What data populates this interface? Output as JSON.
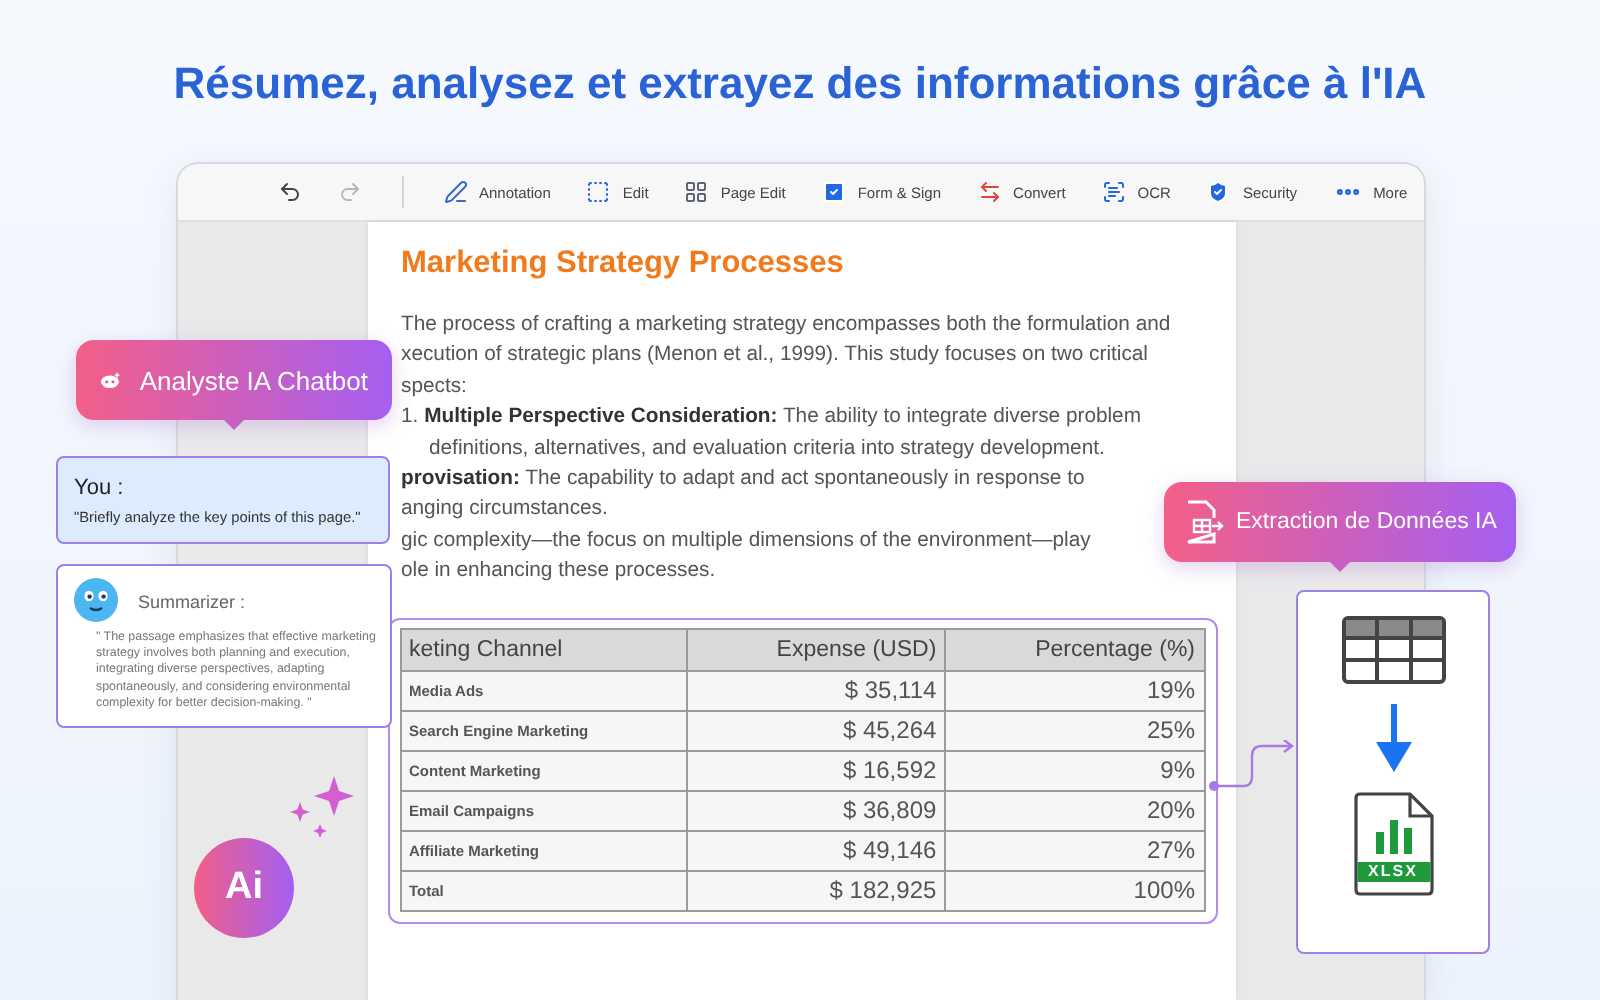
{
  "headline": "Résumez, analysez et extrayez des informations grâce à l'IA",
  "toolbar": {
    "history": [
      {
        "kind": "undo",
        "disabled": false
      },
      {
        "kind": "redo",
        "disabled": true
      }
    ],
    "tools": [
      {
        "kind": "annotation",
        "label": "Annotation"
      },
      {
        "kind": "edit",
        "label": "Edit"
      },
      {
        "kind": "page",
        "label": "Page Edit"
      },
      {
        "kind": "form",
        "label": "Form & Sign"
      },
      {
        "kind": "convert",
        "label": "Convert"
      },
      {
        "kind": "ocr",
        "label": "OCR"
      },
      {
        "kind": "security",
        "label": "Security"
      },
      {
        "kind": "more",
        "label": "More"
      }
    ]
  },
  "document": {
    "title": "Marketing Strategy Processes",
    "lines": [
      {
        "kind": "plain",
        "text": "The process of crafting a marketing strategy encompasses both the formulation and"
      },
      {
        "kind": "plain",
        "text": "xecution of strategic plans (Menon et al., 1999). This study focuses on two critical"
      },
      {
        "kind": "plain",
        "text": "spects:"
      },
      {
        "kind": "plain",
        "text": "1. **Multiple Perspective Consideration:** The ability to integrate diverse problem"
      },
      {
        "kind": "indent",
        "text": "definitions, alternatives, and evaluation criteria into strategy development."
      },
      {
        "kind": "plain",
        "text": "**provisation:** The capability to adapt and act spontaneously in response to"
      },
      {
        "kind": "plain",
        "text": "anging circumstances."
      },
      {
        "kind": "plain",
        "text": "gic complexity—the focus on multiple dimensions of the environment—play"
      },
      {
        "kind": "plain",
        "text": "ole in enhancing these processes."
      }
    ],
    "table": {
      "columns": [
        "keting Channel",
        "Expense (USD)",
        "Percentage (%)"
      ],
      "rows": [
        [
          "Media Ads",
          "$ 35,114",
          "19%"
        ],
        [
          "Search Engine Marketing",
          "$ 45,264",
          "25%"
        ],
        [
          "Content Marketing",
          "$ 16,592",
          "9%"
        ],
        [
          "Email Campaigns",
          "$ 36,809",
          "20%"
        ],
        [
          "Affiliate Marketing",
          "$ 49,146",
          "27%"
        ],
        [
          "Total",
          "$ 182,925",
          "100%"
        ]
      ]
    }
  },
  "chatbot": {
    "title": "Analyste IA Chatbot",
    "user": {
      "label": "You :",
      "message": "\"Briefly analyze the key points of this page.\""
    },
    "reply": {
      "label": "Summarizer :",
      "message": "\" The passage emphasizes that effective marketing strategy involves both planning and execution, integrating diverse perspectives, adapting spontaneously, and considering environmental complexity for better decision-making. \""
    }
  },
  "ai_badge": "Ai",
  "extraction": {
    "title": "Extraction de Données IA",
    "file_label": "XLSX"
  }
}
